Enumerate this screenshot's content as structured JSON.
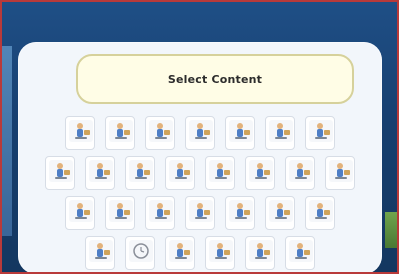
{
  "panel": {
    "title": "Select Content"
  },
  "colors": {
    "border": "#b93a3a",
    "background_blue": "#1f4f86",
    "panel": "#f2f6fb",
    "title_box": "#fffde6",
    "label_red": "#c23a3a"
  },
  "rows": [
    {
      "tiles": [
        {
          "label": "",
          "icon": "person-icon"
        },
        {
          "label": "",
          "icon": "person-icon"
        },
        {
          "label": "",
          "icon": "person-icon"
        },
        {
          "label": "",
          "icon": "person-icon"
        },
        {
          "label": "",
          "icon": "person-icon"
        },
        {
          "label": "",
          "icon": "person-icon"
        },
        {
          "label": "",
          "icon": "person-icon"
        }
      ]
    },
    {
      "tiles": [
        {
          "label": "",
          "icon": "person-icon"
        },
        {
          "label": "",
          "icon": "person-icon"
        },
        {
          "label": "",
          "icon": "person-icon"
        },
        {
          "label": "",
          "icon": "person-icon"
        },
        {
          "label": "",
          "icon": "person-icon"
        },
        {
          "label": "",
          "icon": "person-icon"
        },
        {
          "label": "",
          "icon": "person-icon"
        },
        {
          "label": "",
          "icon": "person-icon"
        }
      ]
    },
    {
      "tiles": [
        {
          "label": "",
          "icon": "person-icon"
        },
        {
          "label": "",
          "icon": "person-icon"
        },
        {
          "label": "",
          "icon": "person-icon"
        },
        {
          "label": "",
          "icon": "person-icon"
        },
        {
          "label": "",
          "icon": "person-icon"
        },
        {
          "label": "",
          "icon": "person-icon"
        },
        {
          "label": "",
          "icon": "person-icon"
        }
      ]
    },
    {
      "tiles": [
        {
          "label": "",
          "icon": "person-icon"
        },
        {
          "label": "",
          "icon": "clock-icon"
        },
        {
          "label": "",
          "icon": "person-icon"
        },
        {
          "label": "",
          "icon": "person-icon"
        },
        {
          "label": "",
          "icon": "person-icon"
        },
        {
          "label": "",
          "icon": "person-icon"
        }
      ]
    }
  ]
}
